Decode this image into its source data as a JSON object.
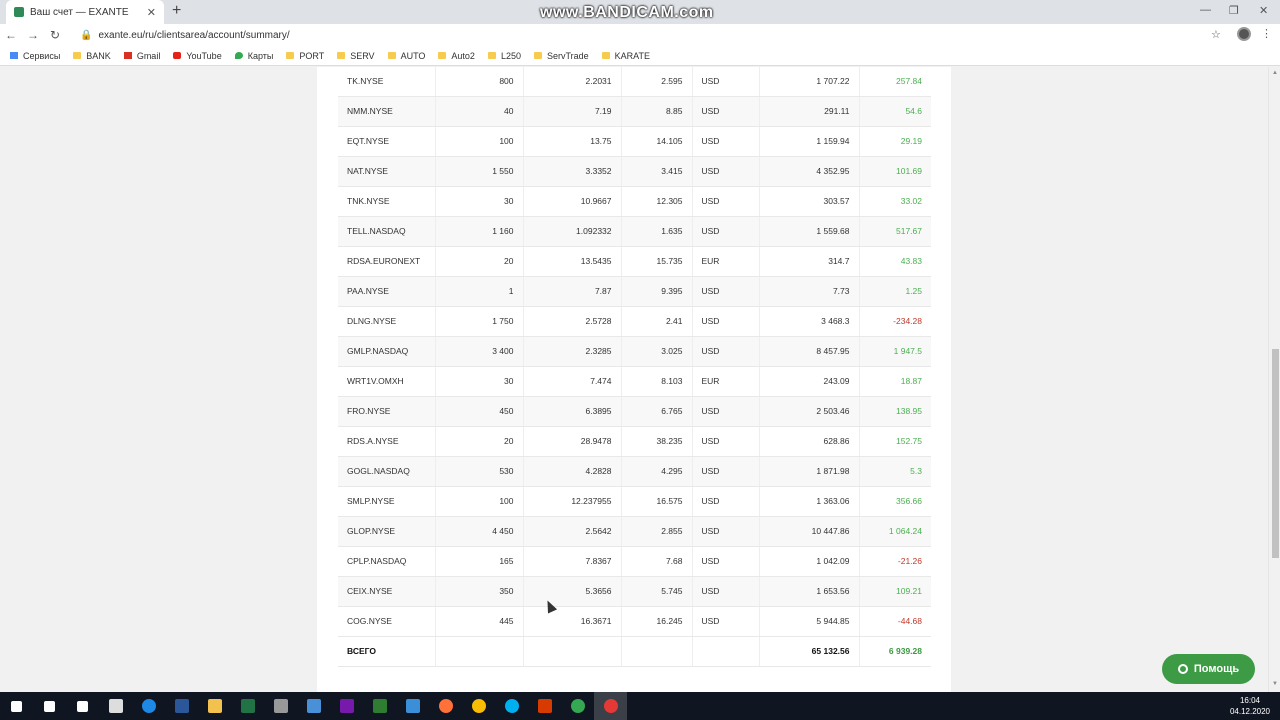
{
  "browser": {
    "tab_title": "Ваш счет — EXANTE",
    "url": "exante.eu/ru/clientsarea/account/summary/",
    "watermark": "www.BANDICAM.com",
    "bookmarks": [
      {
        "label": "Сервисы",
        "icon": "apps-icon"
      },
      {
        "label": "BANK",
        "icon": "folder-icon"
      },
      {
        "label": "Gmail",
        "icon": "gmail-icon"
      },
      {
        "label": "YouTube",
        "icon": "youtube-icon"
      },
      {
        "label": "Карты",
        "icon": "maps-icon"
      },
      {
        "label": "PORT",
        "icon": "folder-icon"
      },
      {
        "label": "SERV",
        "icon": "folder-icon"
      },
      {
        "label": "AUTO",
        "icon": "folder-icon"
      },
      {
        "label": "Auto2",
        "icon": "folder-icon"
      },
      {
        "label": "L250",
        "icon": "folder-icon"
      },
      {
        "label": "ServTrade",
        "icon": "folder-icon"
      },
      {
        "label": "KARATE",
        "icon": "folder-icon"
      }
    ]
  },
  "positions": [
    {
      "symbol": "TK.NYSE",
      "qty": "800",
      "avg": "2.2031",
      "price": "2.595",
      "cur": "USD",
      "value": "1 707.22",
      "pnl": "257.84",
      "sign": "pos"
    },
    {
      "symbol": "NMM.NYSE",
      "qty": "40",
      "avg": "7.19",
      "price": "8.85",
      "cur": "USD",
      "value": "291.11",
      "pnl": "54.6",
      "sign": "pos"
    },
    {
      "symbol": "EQT.NYSE",
      "qty": "100",
      "avg": "13.75",
      "price": "14.105",
      "cur": "USD",
      "value": "1 159.94",
      "pnl": "29.19",
      "sign": "pos"
    },
    {
      "symbol": "NAT.NYSE",
      "qty": "1 550",
      "avg": "3.3352",
      "price": "3.415",
      "cur": "USD",
      "value": "4 352.95",
      "pnl": "101.69",
      "sign": "pos"
    },
    {
      "symbol": "TNK.NYSE",
      "qty": "30",
      "avg": "10.9667",
      "price": "12.305",
      "cur": "USD",
      "value": "303.57",
      "pnl": "33.02",
      "sign": "pos"
    },
    {
      "symbol": "TELL.NASDAQ",
      "qty": "1 160",
      "avg": "1.092332",
      "price": "1.635",
      "cur": "USD",
      "value": "1 559.68",
      "pnl": "517.67",
      "sign": "pos"
    },
    {
      "symbol": "RDSA.EURONEXT",
      "qty": "20",
      "avg": "13.5435",
      "price": "15.735",
      "cur": "EUR",
      "value": "314.7",
      "pnl": "43.83",
      "sign": "pos"
    },
    {
      "symbol": "PAA.NYSE",
      "qty": "1",
      "avg": "7.87",
      "price": "9.395",
      "cur": "USD",
      "value": "7.73",
      "pnl": "1.25",
      "sign": "pos"
    },
    {
      "symbol": "DLNG.NYSE",
      "qty": "1 750",
      "avg": "2.5728",
      "price": "2.41",
      "cur": "USD",
      "value": "3 468.3",
      "pnl": "-234.28",
      "sign": "neg"
    },
    {
      "symbol": "GMLP.NASDAQ",
      "qty": "3 400",
      "avg": "2.3285",
      "price": "3.025",
      "cur": "USD",
      "value": "8 457.95",
      "pnl": "1 947.5",
      "sign": "pos"
    },
    {
      "symbol": "WRT1V.OMXH",
      "qty": "30",
      "avg": "7.474",
      "price": "8.103",
      "cur": "EUR",
      "value": "243.09",
      "pnl": "18.87",
      "sign": "pos"
    },
    {
      "symbol": "FRO.NYSE",
      "qty": "450",
      "avg": "6.3895",
      "price": "6.765",
      "cur": "USD",
      "value": "2 503.46",
      "pnl": "138.95",
      "sign": "pos"
    },
    {
      "symbol": "RDS.A.NYSE",
      "qty": "20",
      "avg": "28.9478",
      "price": "38.235",
      "cur": "USD",
      "value": "628.86",
      "pnl": "152.75",
      "sign": "pos"
    },
    {
      "symbol": "GOGL.NASDAQ",
      "qty": "530",
      "avg": "4.2828",
      "price": "4.295",
      "cur": "USD",
      "value": "1 871.98",
      "pnl": "5.3",
      "sign": "pos"
    },
    {
      "symbol": "SMLP.NYSE",
      "qty": "100",
      "avg": "12.237955",
      "price": "16.575",
      "cur": "USD",
      "value": "1 363.06",
      "pnl": "356.66",
      "sign": "pos"
    },
    {
      "symbol": "GLOP.NYSE",
      "qty": "4 450",
      "avg": "2.5642",
      "price": "2.855",
      "cur": "USD",
      "value": "10 447.86",
      "pnl": "1 064.24",
      "sign": "pos"
    },
    {
      "symbol": "CPLP.NASDAQ",
      "qty": "165",
      "avg": "7.8367",
      "price": "7.68",
      "cur": "USD",
      "value": "1 042.09",
      "pnl": "-21.26",
      "sign": "neg"
    },
    {
      "symbol": "CEIX.NYSE",
      "qty": "350",
      "avg": "5.3656",
      "price": "5.745",
      "cur": "USD",
      "value": "1 653.56",
      "pnl": "109.21",
      "sign": "pos"
    },
    {
      "symbol": "COG.NYSE",
      "qty": "445",
      "avg": "16.3671",
      "price": "16.245",
      "cur": "USD",
      "value": "5 944.85",
      "pnl": "-44.68",
      "sign": "neg"
    }
  ],
  "total": {
    "label": "ВСЕГО",
    "value": "65 132.56",
    "pnl": "6 939.28"
  },
  "help_button": "Помощь",
  "colors": {
    "positive": "#4caf50",
    "negative": "#c0392b",
    "help": "#3d9b46"
  },
  "taskbar": {
    "time": "16:04",
    "date": "04.12.2020",
    "apps": [
      {
        "name": "start-icon",
        "color": "#ffffff"
      },
      {
        "name": "search-icon",
        "color": "#ffffff"
      },
      {
        "name": "task-view-icon",
        "color": "#ffffff"
      },
      {
        "name": "store-icon",
        "color": "#dddddd"
      },
      {
        "name": "edge-icon",
        "color": "#1e88e5"
      },
      {
        "name": "word-icon",
        "color": "#2b579a"
      },
      {
        "name": "file-explorer-icon",
        "color": "#f2c14e"
      },
      {
        "name": "excel-icon",
        "color": "#217346"
      },
      {
        "name": "settings-icon",
        "color": "#999999"
      },
      {
        "name": "calculator-icon",
        "color": "#4a90d9"
      },
      {
        "name": "onenote-icon",
        "color": "#7719aa"
      },
      {
        "name": "lynx-icon",
        "color": "#2e7d32"
      },
      {
        "name": "mail-icon",
        "color": "#3b8ed8"
      },
      {
        "name": "firefox-icon",
        "color": "#ff7139"
      },
      {
        "name": "chrome-icon",
        "color": "#fbbc05"
      },
      {
        "name": "skype-icon",
        "color": "#00aff0"
      },
      {
        "name": "office-icon",
        "color": "#d83b01"
      },
      {
        "name": "chrome-icon-2",
        "color": "#34a853"
      },
      {
        "name": "bandicam-icon",
        "color": "#e53935"
      }
    ]
  }
}
